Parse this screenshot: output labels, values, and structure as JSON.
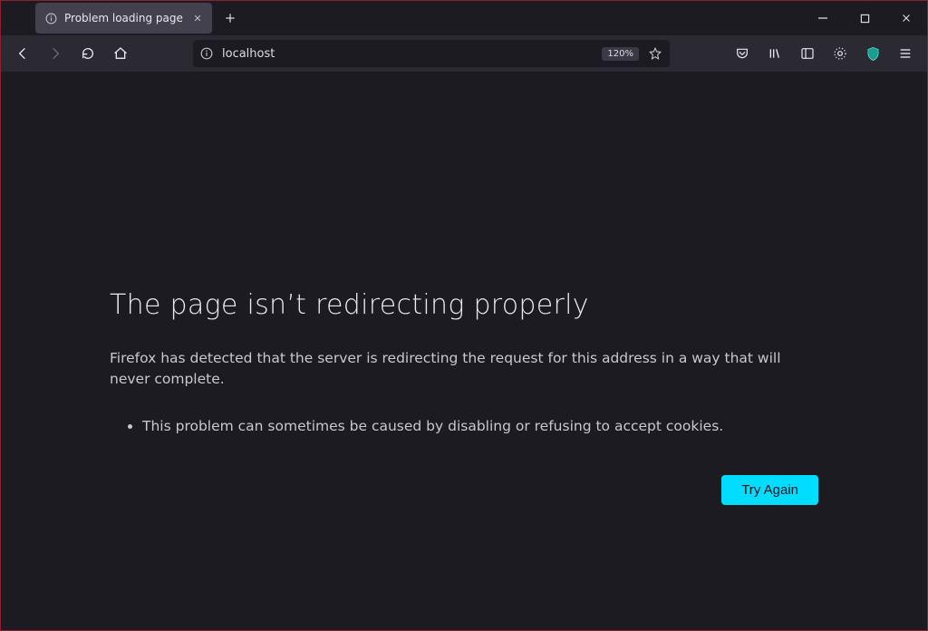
{
  "window": {
    "tab_title": "Problem loading page"
  },
  "urlbar": {
    "url": "localhost",
    "zoom": "120%"
  },
  "error": {
    "heading": "The page isn’t redirecting properly",
    "description": "Firefox has detected that the server is redirecting the request for this address in a way that will never complete.",
    "bullet": "This problem can sometimes be caused by disabling or refusing to accept cookies.",
    "try_again": "Try Again"
  }
}
